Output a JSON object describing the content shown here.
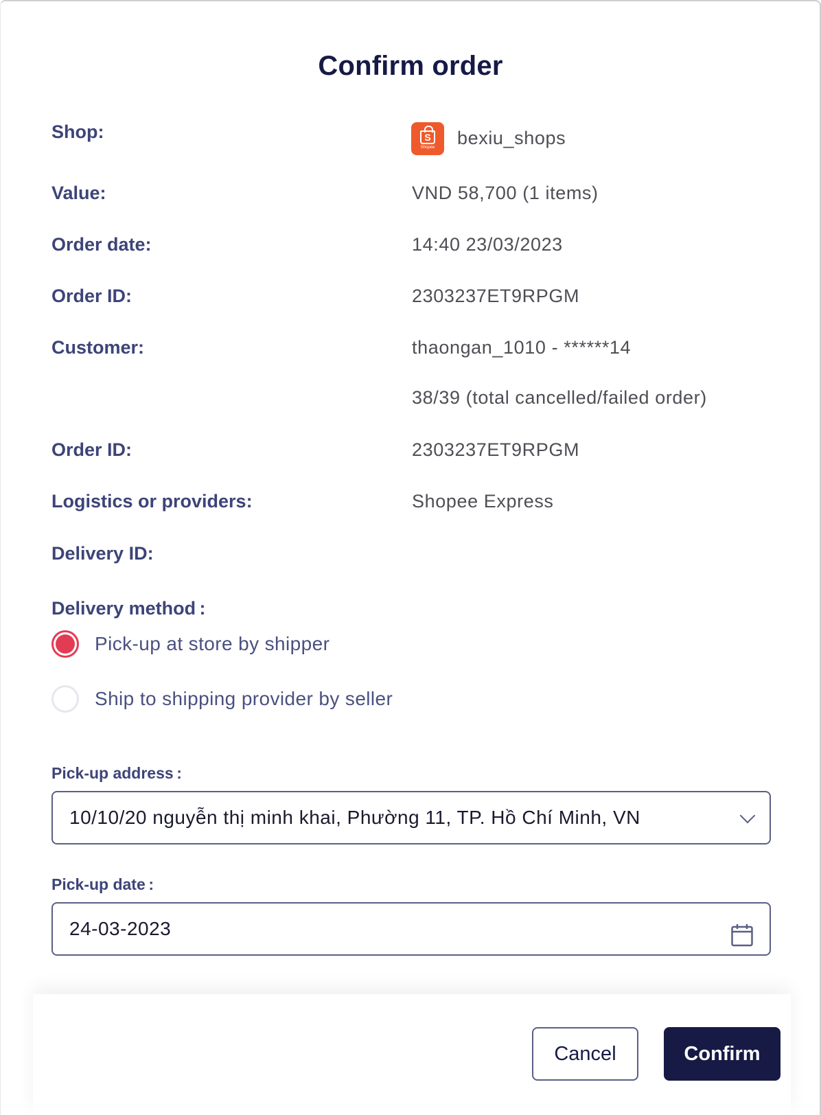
{
  "title": "Confirm order",
  "rows": {
    "shop": {
      "label": "Shop:",
      "value": "bexiu_shops"
    },
    "value": {
      "label": "Value:",
      "value": "VND 58,700 (1 items)"
    },
    "order_date": {
      "label": "Order date:",
      "value": "14:40 23/03/2023"
    },
    "order_id": {
      "label": "Order ID:",
      "value": "2303237ET9RPGM"
    },
    "customer": {
      "label": "Customer:",
      "value": "thaongan_1010 - ******14",
      "extra": "38/39 (total cancelled/failed order)"
    },
    "order_id_2": {
      "label": "Order ID:",
      "value": "2303237ET9RPGM"
    },
    "logistics": {
      "label": "Logistics or providers:",
      "value": "Shopee Express"
    },
    "delivery_id": {
      "label": "Delivery ID:",
      "value": ""
    }
  },
  "shop_logo": {
    "icon": "shopee-bag-icon",
    "letter": "S",
    "caption": "Shopee",
    "color": "#ee5a2c"
  },
  "delivery_method": {
    "label": "Delivery method :",
    "options": [
      {
        "label": "Pick-up at store by shipper",
        "selected": true
      },
      {
        "label": "Ship to shipping provider by seller",
        "selected": false
      }
    ]
  },
  "pickup_address": {
    "label": "Pick-up address :",
    "value": "10/10/20 nguyễn thị minh khai, Phường 11, TP. Hồ Chí Minh, VN"
  },
  "pickup_date": {
    "label": "Pick-up date :",
    "value": "24-03-2023"
  },
  "buttons": {
    "cancel": "Cancel",
    "confirm": "Confirm"
  },
  "colors": {
    "accent": "#161a45",
    "radio_selected": "#e23c54",
    "label": "#3d4478"
  }
}
